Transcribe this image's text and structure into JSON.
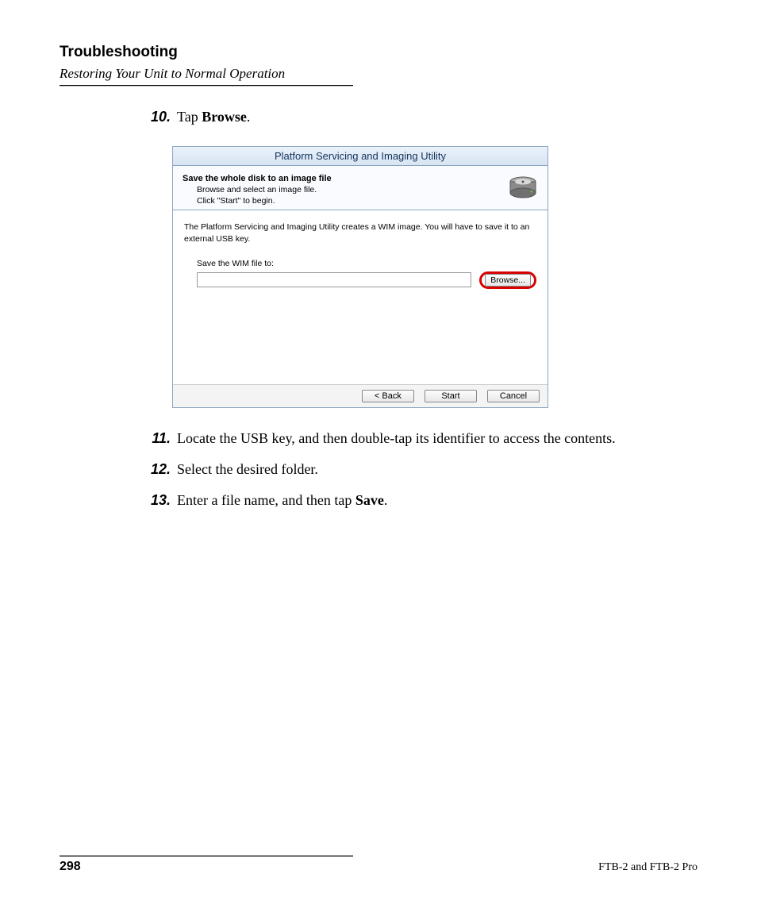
{
  "header": {
    "chapter": "Troubleshooting",
    "section": "Restoring Your Unit to Normal Operation"
  },
  "steps": {
    "s10": {
      "num": "10.",
      "pre": "Tap ",
      "bold": "Browse",
      "post": "."
    },
    "s11": {
      "num": "11.",
      "text": "Locate the USB key, and then double-tap its identifier to access the contents."
    },
    "s12": {
      "num": "12.",
      "text": "Select the desired folder."
    },
    "s13": {
      "num": "13.",
      "pre": "Enter a file name, and then tap ",
      "bold": "Save",
      "post": "."
    }
  },
  "dialog": {
    "title": "Platform Servicing and Imaging Utility",
    "head_title": "Save the whole disk to an image file",
    "head_line1": "Browse and select an image file.",
    "head_line2": "Click \"Start\" to begin.",
    "body_desc": "The Platform Servicing and Imaging Utility creates a WIM image. You will have to save it to an external USB key.",
    "save_label": "Save the WIM file to:",
    "browse": "Browse...",
    "back": "< Back",
    "start": "Start",
    "cancel": "Cancel"
  },
  "footer": {
    "page": "298",
    "doc": "FTB-2 and FTB-2 Pro"
  }
}
